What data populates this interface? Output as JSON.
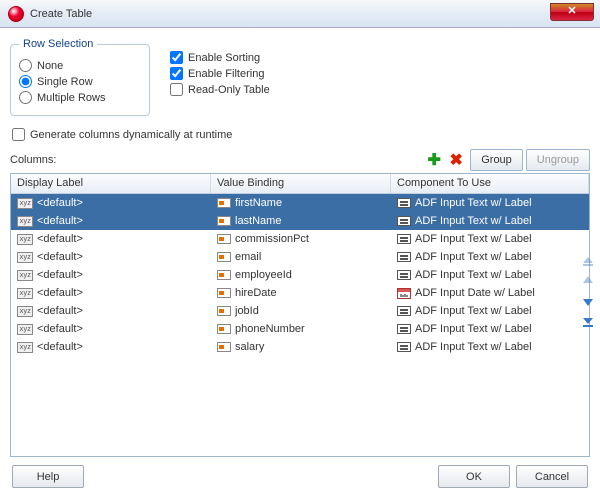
{
  "window": {
    "title": "Create Table"
  },
  "rowSelection": {
    "legend": "Row Selection",
    "options": {
      "none": "None",
      "single": "Single Row",
      "multiple": "Multiple Rows"
    },
    "selected": "single"
  },
  "tableOptions": {
    "enableSorting": {
      "label": "Enable Sorting",
      "checked": true
    },
    "enableFiltering": {
      "label": "Enable Filtering",
      "checked": true
    },
    "readOnly": {
      "label": "Read-Only Table",
      "checked": false
    }
  },
  "dynamicColumns": {
    "label": "Generate columns dynamically at runtime",
    "checked": false
  },
  "columnsLabel": "Columns:",
  "toolbar": {
    "group": "Group",
    "ungroup": "Ungroup"
  },
  "grid": {
    "headers": {
      "displayLabel": "Display Label",
      "valueBinding": "Value Binding",
      "componentToUse": "Component To Use"
    },
    "rows": [
      {
        "displayLabel": "<default>",
        "valueBinding": "firstName",
        "component": "ADF Input Text w/ Label",
        "compIcon": "text",
        "selected": true
      },
      {
        "displayLabel": "<default>",
        "valueBinding": "lastName",
        "component": "ADF Input Text w/ Label",
        "compIcon": "text",
        "selected": true
      },
      {
        "displayLabel": "<default>",
        "valueBinding": "commissionPct",
        "component": "ADF Input Text w/ Label",
        "compIcon": "text",
        "selected": false
      },
      {
        "displayLabel": "<default>",
        "valueBinding": "email",
        "component": "ADF Input Text w/ Label",
        "compIcon": "text",
        "selected": false
      },
      {
        "displayLabel": "<default>",
        "valueBinding": "employeeId",
        "component": "ADF Input Text w/ Label",
        "compIcon": "text",
        "selected": false
      },
      {
        "displayLabel": "<default>",
        "valueBinding": "hireDate",
        "component": "ADF Input Date w/ Label",
        "compIcon": "date",
        "selected": false
      },
      {
        "displayLabel": "<default>",
        "valueBinding": "jobId",
        "component": "ADF Input Text w/ Label",
        "compIcon": "text",
        "selected": false
      },
      {
        "displayLabel": "<default>",
        "valueBinding": "phoneNumber",
        "component": "ADF Input Text w/ Label",
        "compIcon": "text",
        "selected": false
      },
      {
        "displayLabel": "<default>",
        "valueBinding": "salary",
        "component": "ADF Input Text w/ Label",
        "compIcon": "text",
        "selected": false
      }
    ]
  },
  "footer": {
    "help": "Help",
    "ok": "OK",
    "cancel": "Cancel"
  }
}
